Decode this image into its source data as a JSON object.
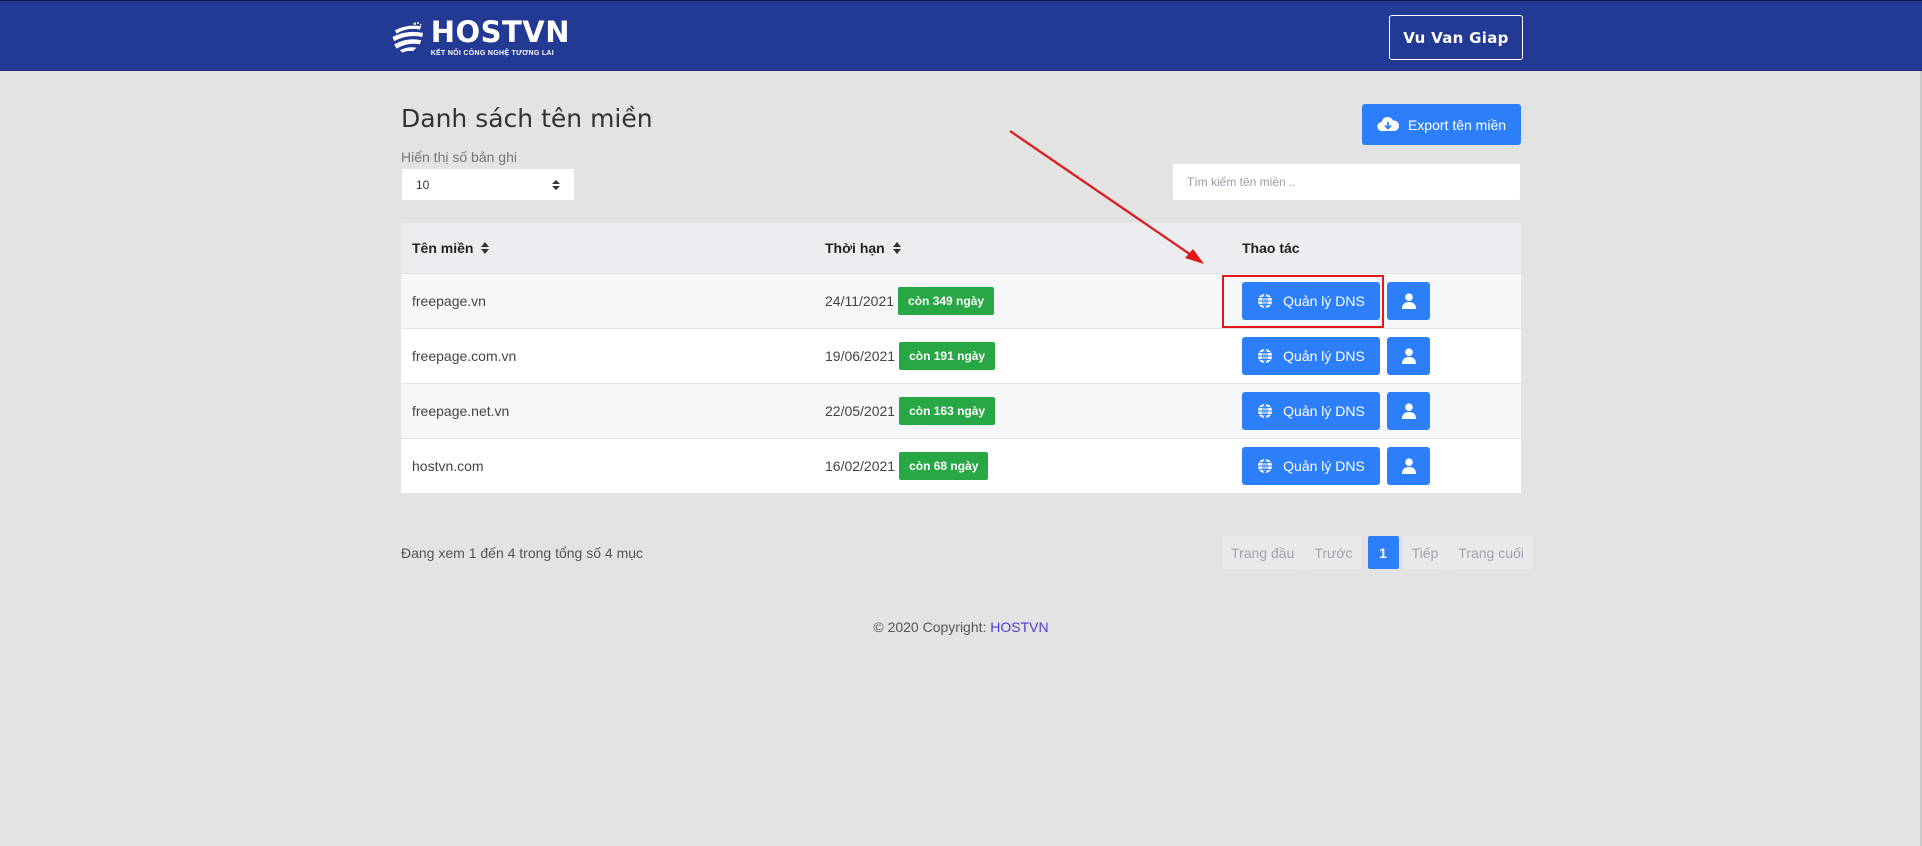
{
  "header": {
    "logo_name": "HOSTVN",
    "logo_tagline": "KẾT NỐI CÔNG NGHỆ TƯƠNG LAI",
    "user_name": "Vu Van Giap"
  },
  "main": {
    "title": "Danh sách tên miền",
    "export_label": "Export tên miền",
    "show_label": "Hiển thị số bản ghi",
    "page_size": "10",
    "search_placeholder": "Tìm kiếm tên miền ..",
    "search_value": ""
  },
  "table": {
    "headers": {
      "domain": "Tên miền",
      "expiry": "Thời hạn",
      "actions": "Thao tác"
    },
    "dns_label": "Quản lý DNS",
    "rows": [
      {
        "domain": "freepage.vn",
        "date": "24/11/2021",
        "remaining": "còn 349 ngày"
      },
      {
        "domain": "freepage.com.vn",
        "date": "19/06/2021",
        "remaining": "còn 191 ngày"
      },
      {
        "domain": "freepage.net.vn",
        "date": "22/05/2021",
        "remaining": "còn 163 ngày"
      },
      {
        "domain": "hostvn.com",
        "date": "16/02/2021",
        "remaining": "còn 68 ngày"
      }
    ]
  },
  "pagination": {
    "showing": "Đang xem 1 đến 4 trong tổng số 4 mục",
    "first": "Trang đầu",
    "prev": "Trước",
    "current": "1",
    "next": "Tiếp",
    "last": "Trang cuối"
  },
  "footer": {
    "copyright": "© 2020 Copyright:",
    "brand": "HOSTVN"
  },
  "colors": {
    "header_bg": "#233a94",
    "primary": "#2d7ff9",
    "success": "#28a745",
    "annotation": "#e01818"
  }
}
